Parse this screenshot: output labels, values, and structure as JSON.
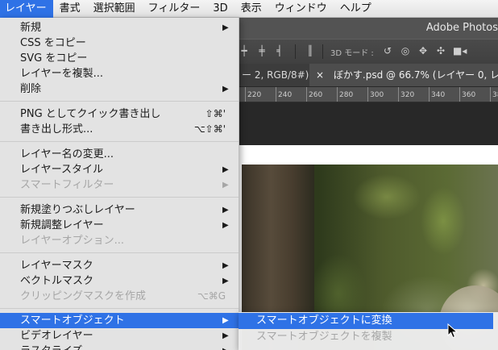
{
  "menubar": {
    "items": [
      "レイヤー",
      "書式",
      "選択範囲",
      "フィルター",
      "3D",
      "表示",
      "ウィンドウ",
      "ヘルプ"
    ],
    "active_index": 0
  },
  "app": {
    "title": "Adobe Photos",
    "options_bar": {
      "mode3d_label": "3D モード :"
    },
    "tabs": {
      "tab1": "ー 2, RGB/8#)",
      "tab2_close": "×",
      "tab2": "ぼかす.psd @ 66.7% (レイヤー 0, レイ"
    },
    "ruler": [
      "220",
      "240",
      "260",
      "280",
      "300",
      "320",
      "340",
      "360",
      "38"
    ]
  },
  "menu": {
    "groups": [
      [
        {
          "label": "新規",
          "submenu": true
        },
        {
          "label": "CSS をコピー"
        },
        {
          "label": "SVG をコピー"
        },
        {
          "label": "レイヤーを複製..."
        },
        {
          "label": "削除",
          "submenu": true
        }
      ],
      [
        {
          "label": "PNG としてクイック書き出し",
          "shortcut": "⇧⌘'"
        },
        {
          "label": "書き出し形式...",
          "shortcut": "⌥⇧⌘'"
        }
      ],
      [
        {
          "label": "レイヤー名の変更..."
        },
        {
          "label": "レイヤースタイル",
          "submenu": true
        },
        {
          "label": "スマートフィルター",
          "submenu": true,
          "disabled": true
        }
      ],
      [
        {
          "label": "新規塗りつぶしレイヤー",
          "submenu": true
        },
        {
          "label": "新規調整レイヤー",
          "submenu": true
        },
        {
          "label": "レイヤーオプション...",
          "disabled": true
        }
      ],
      [
        {
          "label": "レイヤーマスク",
          "submenu": true
        },
        {
          "label": "ベクトルマスク",
          "submenu": true
        },
        {
          "label": "クリッピングマスクを作成",
          "shortcut": "⌥⌘G",
          "disabled": true
        }
      ],
      [
        {
          "label": "スマートオブジェクト",
          "submenu": true,
          "highlighted": true
        },
        {
          "label": "ビデオレイヤー",
          "submenu": true
        },
        {
          "label": "ラスタライズ",
          "submenu": true
        }
      ]
    ],
    "arrow_glyph": "▶"
  },
  "submenu": {
    "items": [
      {
        "label": "スマートオブジェクトに変換",
        "highlighted": true
      },
      {
        "label": "スマートオブジェクトを複製",
        "disabled": true
      }
    ]
  },
  "colors": {
    "accent": "#2f72e6",
    "menu_bg": "#e8e8e8",
    "app_bg": "#535353"
  }
}
